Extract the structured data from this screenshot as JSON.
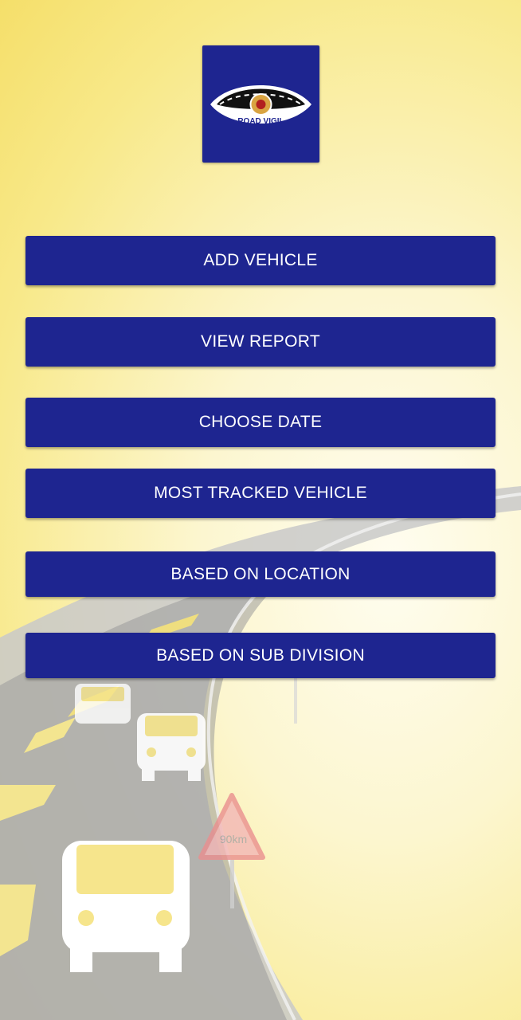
{
  "app": {
    "logo_text": "ROAD VIGIL",
    "logo_icon": "road-vigil-eye-logo"
  },
  "menu": {
    "add_vehicle": "ADD VEHICLE",
    "view_report": "VIEW REPORT",
    "choose_date": "CHOOSE DATE",
    "most_tracked_vehicle": "MOST TRACKED VEHICLE",
    "based_on_location": "BASED ON LOCATION",
    "based_on_sub_division": "BASED ON SUB DIVISION"
  },
  "background": {
    "sign_text": "90km"
  },
  "colors": {
    "primary": "#1e2590",
    "background_yellow": "#f8e98a",
    "button_text": "#ffffff"
  }
}
